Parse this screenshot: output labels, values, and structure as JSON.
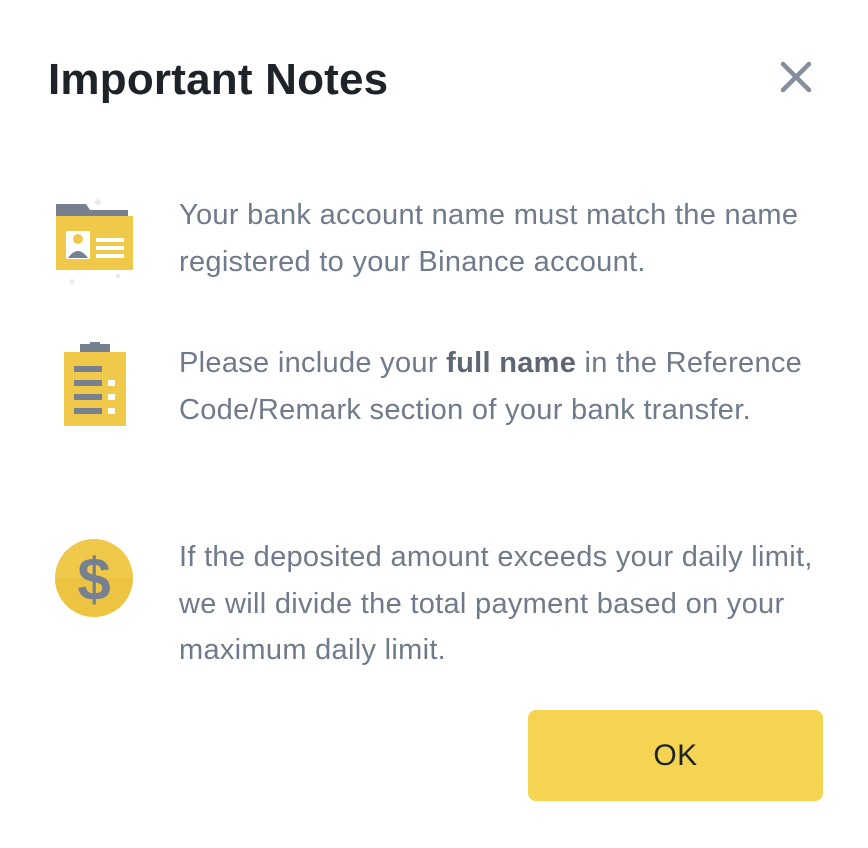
{
  "dialog": {
    "title": "Important Notes",
    "close_icon": "close-icon"
  },
  "notes": [
    {
      "icon": "id-card-folder-icon",
      "text": "Your bank account name must match the name registered to your Binance account."
    },
    {
      "icon": "clipboard-list-icon",
      "text_before": "Please include your ",
      "text_bold": "full name",
      "text_after": " in the Reference Code/Remark section of your bank transfer."
    },
    {
      "icon": "dollar-coin-icon",
      "text": "If the deposited amount exceeds your daily limit, we will divide the total payment based on your maximum daily limit."
    }
  ],
  "actions": {
    "ok_label": "OK"
  },
  "colors": {
    "accent": "#f5d451",
    "title": "#1e2329",
    "body_text": "#707a8a",
    "icon_yellow": "#f0c94a",
    "icon_gray": "#76808f"
  }
}
